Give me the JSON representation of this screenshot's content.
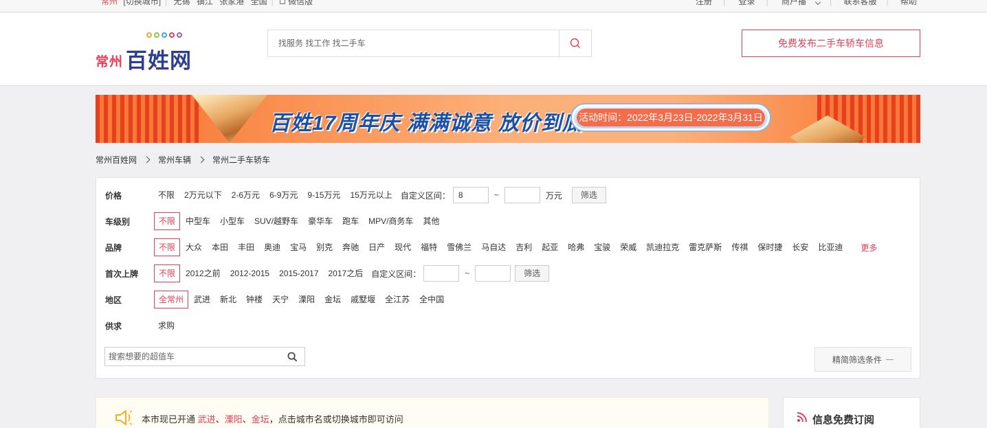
{
  "topbar": {
    "city": "常州",
    "switch_city": "[切换城市]",
    "nearby": [
      "无锡",
      "镇江",
      "张家港",
      "全国"
    ],
    "wechat": "微信版",
    "register": "注册",
    "login": "登录",
    "merchant": "商户播",
    "service": "联系客服",
    "help": "帮助"
  },
  "logo": {
    "city": "常州",
    "brand": "百姓网"
  },
  "search": {
    "placeholder": "找服务 找工作 找二手车"
  },
  "publish_label": "免费发布二手车轿车信息",
  "banner": {
    "title": "百姓17周年庆 满满诚意 放价到底",
    "period": "活动时间：2022年3月23日-2022年3月31日"
  },
  "breadcrumb": [
    "常州百姓网",
    "常州车辆",
    "常州二手车轿车"
  ],
  "filters": {
    "price": {
      "label": "价格",
      "options": [
        "不限",
        "2万元以下",
        "2-6万元",
        "6-9万元",
        "9-15万元",
        "15万元以上"
      ],
      "custom_label": "自定义区间：",
      "min_value": "8",
      "max_value": "",
      "unit": "万元",
      "button": "筛选"
    },
    "level": {
      "label": "车级别",
      "options": [
        "不限",
        "中型车",
        "小型车",
        "SUV/越野车",
        "豪华车",
        "跑车",
        "MPV/商务车",
        "其他"
      ]
    },
    "brand": {
      "label": "品牌",
      "options": [
        "不限",
        "大众",
        "本田",
        "丰田",
        "奥迪",
        "宝马",
        "别克",
        "奔驰",
        "日产",
        "现代",
        "福特",
        "雪佛兰",
        "马自达",
        "吉利",
        "起亚",
        "哈弗",
        "宝骏",
        "荣威",
        "凯迪拉克",
        "雷克萨斯",
        "传祺",
        "保时捷",
        "长安",
        "比亚迪"
      ],
      "more": "更多"
    },
    "first_reg": {
      "label": "首次上牌",
      "options": [
        "不限",
        "2012之前",
        "2012-2015",
        "2015-2017",
        "2017之后"
      ],
      "custom_label": "自定义区间：",
      "min_value": "",
      "max_value": "",
      "button": "筛选"
    },
    "area": {
      "label": "地区",
      "options": [
        "全常州",
        "武进",
        "新北",
        "钟楼",
        "天宁",
        "溧阳",
        "金坛",
        "戚墅堰",
        "全江苏",
        "全中国"
      ]
    },
    "supply": {
      "label": "供求",
      "options": [
        "求购"
      ]
    },
    "keyword_placeholder": "搜索想要的超值车",
    "collapse_label": "精简筛选条件",
    "tilde": "~"
  },
  "notice": {
    "prefix": "本市现已开通",
    "cities": [
      "武进",
      "溧阳",
      "金坛"
    ],
    "sep": "、",
    "suffix": "，点击城市名或切换城市即可访问"
  },
  "subscribe_title": "信息免费订阅",
  "colors": {
    "accent": "#e33f57",
    "brand_blue": "#2c3e8f"
  }
}
